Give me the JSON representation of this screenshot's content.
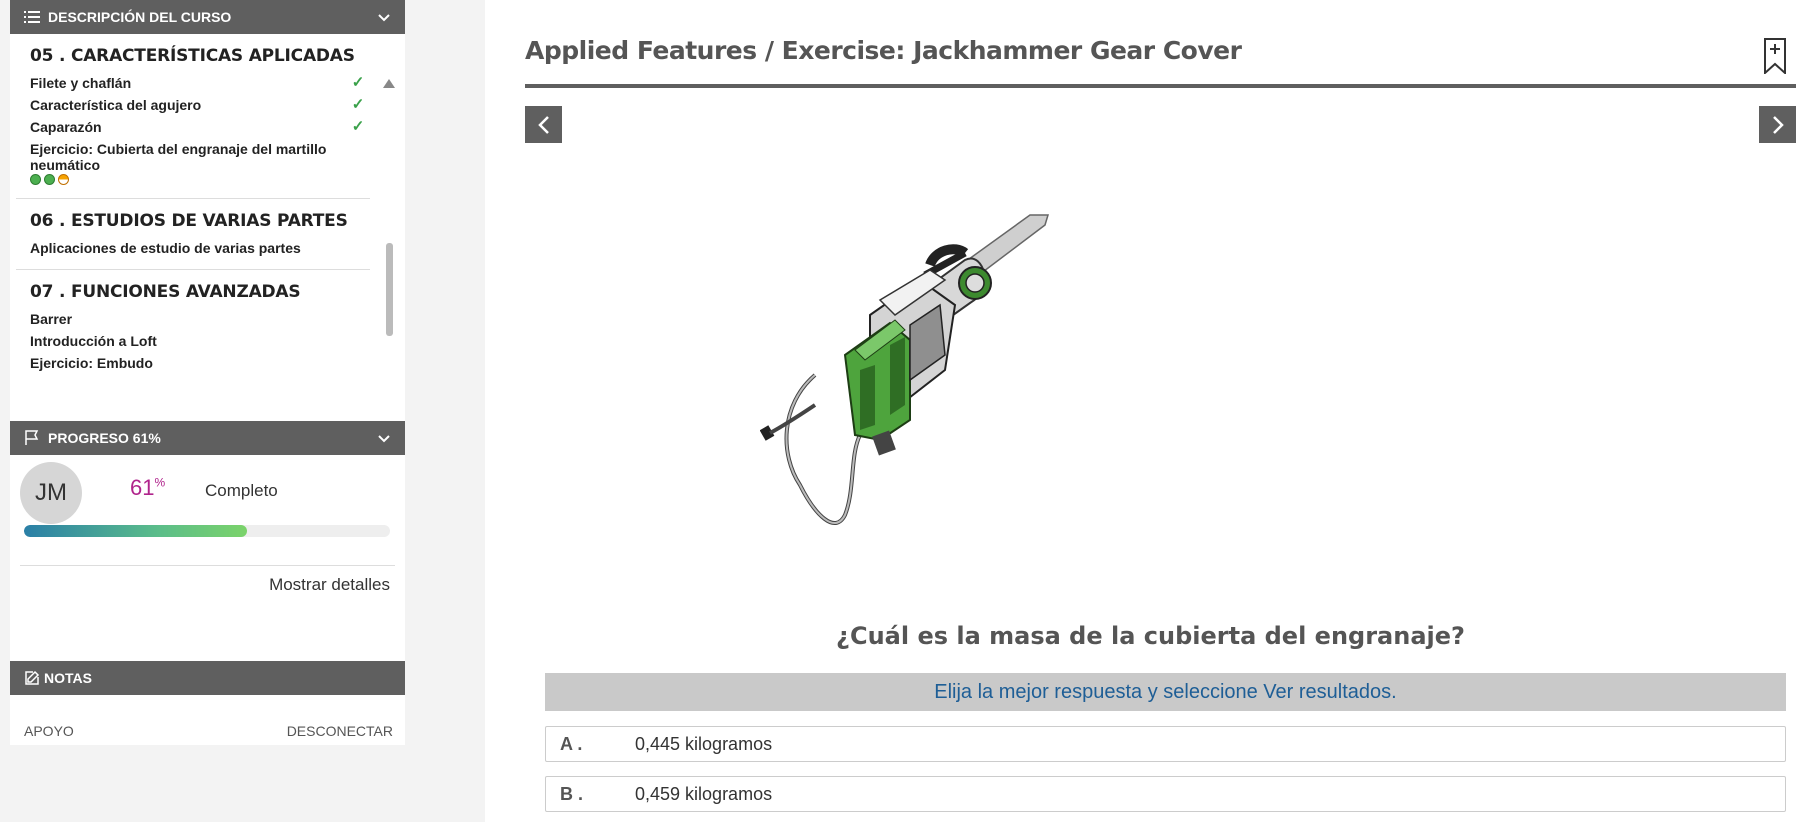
{
  "sidebar": {
    "course_header": "DESCRIPCIÓN DEL CURSO",
    "sections": [
      {
        "title": "05 . CARACTERÍSTICAS APLICADAS",
        "items": [
          {
            "label": "Filete y chaflán",
            "completed": true
          },
          {
            "label": "Característica del agujero",
            "completed": true
          },
          {
            "label": "Caparazón",
            "completed": true
          },
          {
            "label": "Ejercicio: Cubierta del engranaje del martillo neumático",
            "completed": false
          }
        ]
      },
      {
        "title": "06 . ESTUDIOS DE VARIAS PARTES",
        "items": [
          {
            "label": "Aplicaciones de estudio de varias partes"
          }
        ]
      },
      {
        "title": "07 . FUNCIONES AVANZADAS",
        "items": [
          {
            "label": "Barrer"
          },
          {
            "label": "Introducción a Loft"
          },
          {
            "label": "Ejercicio: Embudo"
          }
        ]
      }
    ],
    "progress_header": "PROGRESO 61%",
    "avatar_initials": "JM",
    "progress_value": "61",
    "progress_unit": "%",
    "progress_fraction": 0.61,
    "complete_label": "Completo",
    "show_details": "Mostrar detalles",
    "notes_header": "NOTAS",
    "support_link": "APOYO",
    "logout_link": "DESCONECTAR"
  },
  "main": {
    "title": "Applied Features / Exercise: Jackhammer Gear Cover",
    "question": "¿Cuál es la masa de la cubierta del engranaje?",
    "instruction": "Elija la mejor respuesta y seleccione Ver resultados.",
    "options": [
      {
        "letter": "A .",
        "text": "0,445 kilogramos"
      },
      {
        "letter": "B .",
        "text": "0,459 kilogramos"
      }
    ]
  },
  "colors": {
    "header_bar": "#5f5f5f",
    "progress_accent": "#b0248c",
    "check": "#3aa14a",
    "instruction_text": "#1e5e96"
  }
}
